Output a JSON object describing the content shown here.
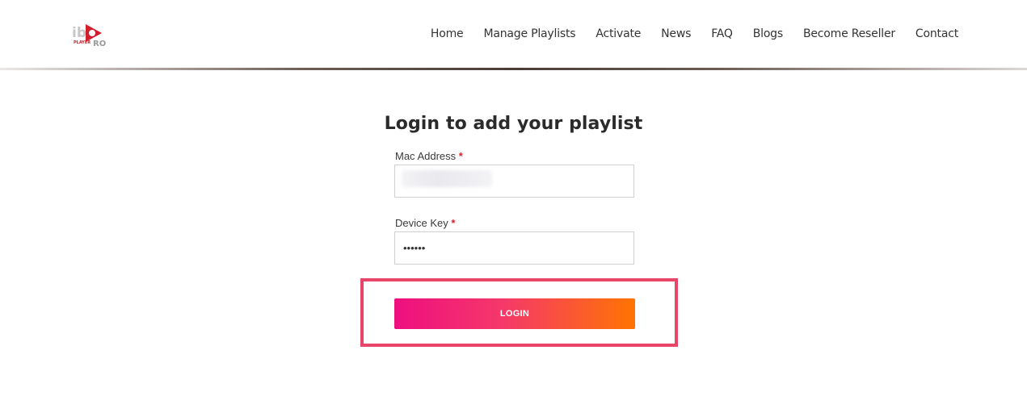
{
  "brand": {
    "logo_text": "ibo PLAYER PRO"
  },
  "nav": {
    "items": [
      "Home",
      "Manage Playlists",
      "Activate",
      "News",
      "FAQ",
      "Blogs",
      "Become Reseller",
      "Contact"
    ]
  },
  "form": {
    "title": "Login to add your playlist",
    "mac_label": "Mac Address",
    "mac_value": "",
    "device_key_label": "Device Key",
    "device_key_value": "••••••",
    "required_mark": "*",
    "login_label": "LOGIN"
  },
  "colors": {
    "accent_start": "#ee0f7f",
    "accent_end": "#ff7402",
    "highlight_border": "#e84569",
    "required": "#e01e2b"
  }
}
